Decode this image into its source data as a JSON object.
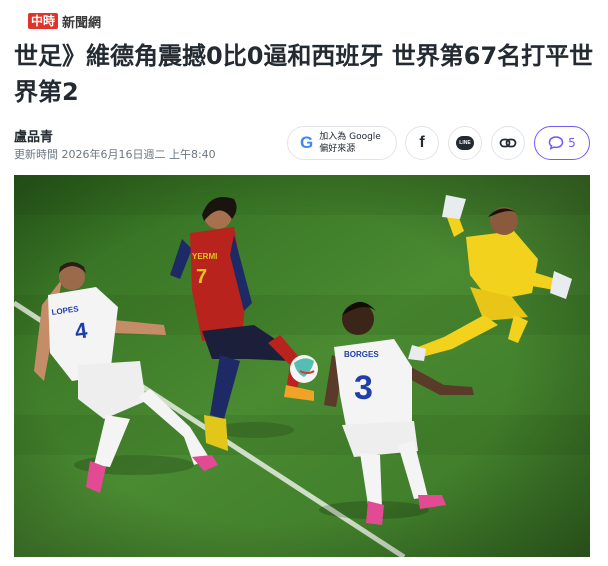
{
  "brand": {
    "badge": "中時",
    "name": "新聞網"
  },
  "article": {
    "headline": "世足》維德角震撼0比0逼和西班牙 世界第67名打平世界第2",
    "author": "盧品青",
    "timestamp": "更新時間 2026年6月16日週二 上午8:40"
  },
  "share": {
    "google_line1": "加入為 Google",
    "google_line2": "偏好來源",
    "facebook_glyph": "f",
    "line_glyph": "LINE",
    "comment_count": "5"
  },
  "photo": {
    "players": [
      {
        "name": "LOPES",
        "number": "4"
      },
      {
        "name": "YERMI",
        "number": "7"
      },
      {
        "name": "BORGES",
        "number": "3"
      }
    ]
  },
  "colors": {
    "accent": "#7759f5",
    "brand_red": "#e0332a",
    "pitch_green": "#3f7d2a",
    "spain_red": "#b8231d",
    "keeper_yellow": "#f2d21c"
  }
}
